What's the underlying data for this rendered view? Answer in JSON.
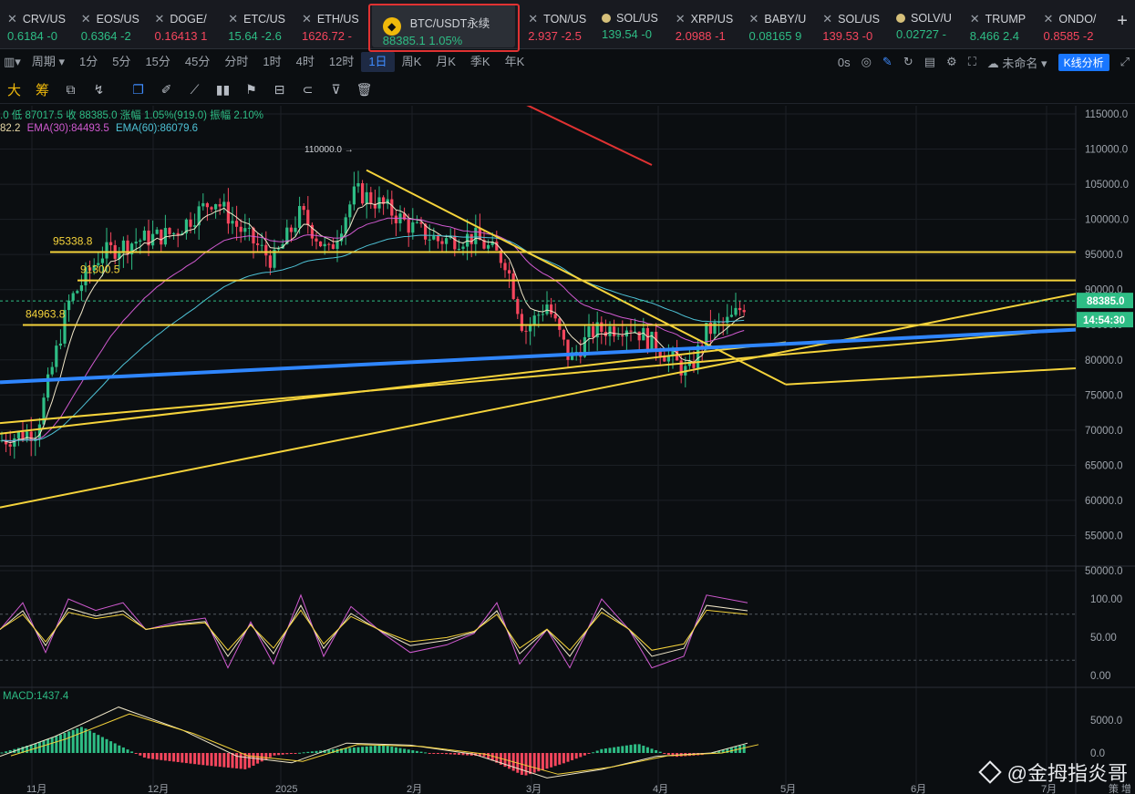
{
  "tickers": [
    {
      "symbol": "CRV/US",
      "price": "0.6184",
      "change": "-0",
      "dir": "up"
    },
    {
      "symbol": "EOS/US",
      "price": "0.6364",
      "change": "-2",
      "dir": "up"
    },
    {
      "symbol": "DOGE/",
      "price": "0.16413",
      "change": "1",
      "dir": "down"
    },
    {
      "symbol": "ETC/US",
      "price": "15.64",
      "change": "-2.6",
      "dir": "up"
    },
    {
      "symbol": "ETH/US",
      "price": "1626.72",
      "change": "-",
      "dir": "down"
    },
    {
      "symbol": "BTC/USDT永续",
      "price": "88385.1",
      "change": "1.05%",
      "dir": "up",
      "active": true
    },
    {
      "symbol": "TON/US",
      "price": "2.937",
      "change": "-2.5",
      "dir": "down"
    },
    {
      "symbol": "SOL/US",
      "price": "139.54",
      "change": "-0",
      "dir": "up"
    },
    {
      "symbol": "XRP/US",
      "price": "2.0988",
      "change": "-1",
      "dir": "down"
    },
    {
      "symbol": "BABY/U",
      "price": "0.08165",
      "change": "9",
      "dir": "up"
    },
    {
      "symbol": "SOL/US",
      "price": "139.53",
      "change": "-0",
      "dir": "down"
    },
    {
      "symbol": "SOLV/U",
      "price": "0.02727",
      "change": "-",
      "dir": "up"
    },
    {
      "symbol": "TRUMP",
      "price": "8.466",
      "change": "2.4",
      "dir": "up"
    },
    {
      "symbol": "ONDO/",
      "price": "0.8585",
      "change": "-2",
      "dir": "down"
    }
  ],
  "add_tab": "+",
  "period_bar": {
    "period_label": "周期",
    "intervals": [
      "1分",
      "5分",
      "15分",
      "45分",
      "分时",
      "1时",
      "4时",
      "12时",
      "1日",
      "周K",
      "月K",
      "季K",
      "年K"
    ],
    "selected": "1日",
    "timer": "0s",
    "layout_name": "未命名",
    "analysis_button": "K线分析"
  },
  "draw_tools": {
    "big": "大",
    "chip": "筹"
  },
  "ohlc_legend": ".0  低 87017.5  收 88385.0  涨幅 1.05%(919.0)  振幅 2.10%",
  "ema_legend": {
    "first": "82.2",
    "ema30": "EMA(30):84493.5",
    "ema60": "EMA(60):86079.6"
  },
  "macd_label": "MACD:1437.4",
  "price_axis": [
    "115000.0",
    "110000.0",
    "105000.0",
    "100000.0",
    "95000.0",
    "90000.0",
    "85000.0",
    "80000.0",
    "75000.0",
    "70000.0",
    "65000.0",
    "60000.0",
    "55000.0",
    "50000.0"
  ],
  "current_price_tag": "88385.0",
  "countdown_tag": "14:54:30",
  "high_marker": "110000.0 →",
  "level_labels": [
    "95338.8",
    "91300.5",
    "84963.8"
  ],
  "kdj_axis": [
    "100.00",
    "50.00",
    "0.00"
  ],
  "macd_axis": [
    "5000.0",
    "0.0"
  ],
  "date_axis": [
    "11月",
    "12月",
    "2025",
    "2月",
    "3月",
    "4月",
    "5月",
    "6月",
    "7月",
    "策 增"
  ],
  "watermark": "@金拇指炎哥",
  "colors": {
    "up": "#2ebd85",
    "down": "#f6465d",
    "trendline": "#f5d33b",
    "support": "#2f86ff",
    "ema_fast": "#f0e6c8",
    "ema30": "#d05ad0",
    "ema60": "#4ec2d6"
  }
}
